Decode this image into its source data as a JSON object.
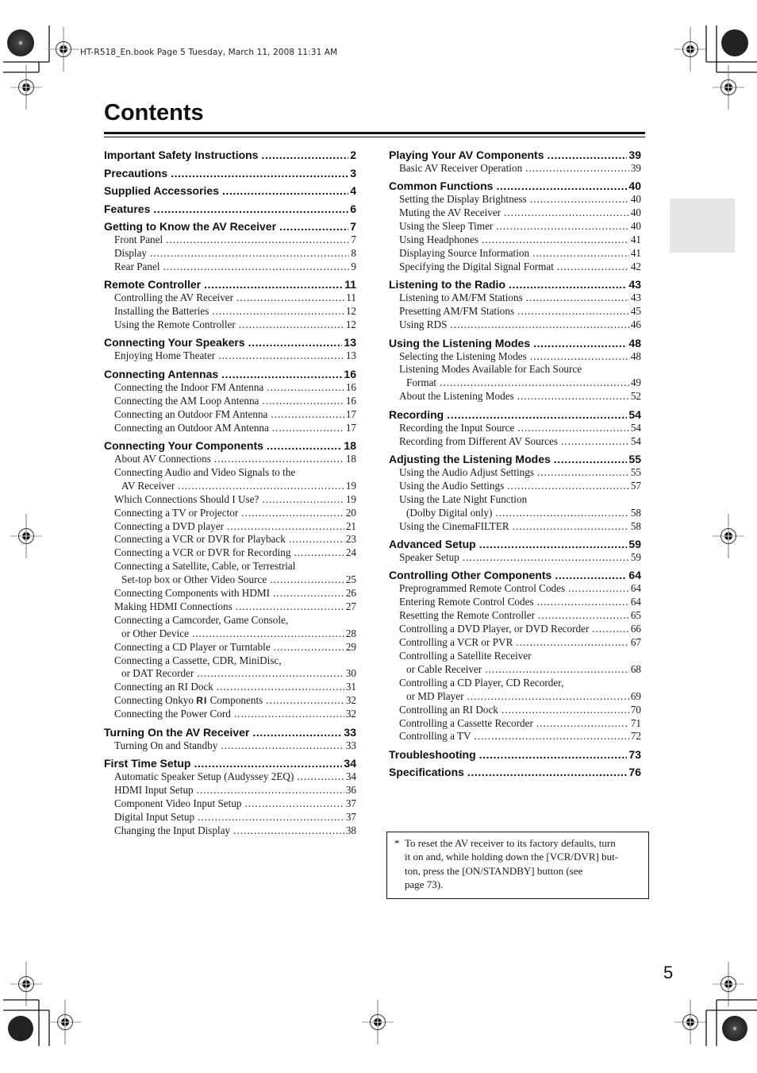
{
  "header": {
    "print_info": "HT-R518_En.book  Page 5  Tuesday, March 11, 2008  11:31 AM"
  },
  "title": "Contents",
  "left_column": [
    {
      "title": "Important Safety Instructions",
      "page": "2",
      "subs": []
    },
    {
      "title": "Precautions",
      "page": "3",
      "subs": []
    },
    {
      "title": "Supplied Accessories",
      "page": "4",
      "subs": []
    },
    {
      "title": "Features",
      "page": "6",
      "subs": []
    },
    {
      "title": "Getting to Know the AV Receiver",
      "page": "7",
      "subs": [
        {
          "title": "Front Panel",
          "page": "7"
        },
        {
          "title": "Display",
          "page": "8"
        },
        {
          "title": "Rear Panel",
          "page": "9"
        }
      ]
    },
    {
      "title": "Remote Controller",
      "page": "11",
      "subs": [
        {
          "title": "Controlling the AV Receiver",
          "page": "11"
        },
        {
          "title": "Installing the Batteries",
          "page": "12"
        },
        {
          "title": "Using the Remote Controller",
          "page": "12"
        }
      ]
    },
    {
      "title": "Connecting Your Speakers",
      "page": "13",
      "subs": [
        {
          "title": "Enjoying Home Theater",
          "page": "13"
        }
      ]
    },
    {
      "title": "Connecting Antennas",
      "page": "16",
      "subs": [
        {
          "title": "Connecting the Indoor FM Antenna",
          "page": "16"
        },
        {
          "title": "Connecting the AM Loop Antenna",
          "page": "16"
        },
        {
          "title": "Connecting an Outdoor FM Antenna",
          "page": "17"
        },
        {
          "title": "Connecting an Outdoor AM Antenna",
          "page": "17"
        }
      ]
    },
    {
      "title": "Connecting Your Components",
      "page": "18",
      "subs": [
        {
          "title": "About AV Connections",
          "page": "18"
        },
        {
          "title": "Connecting Audio and Video Signals to the",
          "cont": "AV Receiver",
          "page": "19"
        },
        {
          "title": "Which Connections Should I Use?",
          "page": "19"
        },
        {
          "title": "Connecting a TV or Projector",
          "page": "20"
        },
        {
          "title": "Connecting a DVD player",
          "page": "21"
        },
        {
          "title": "Connecting a VCR or DVR for Playback",
          "page": "23"
        },
        {
          "title": "Connecting a VCR or DVR for Recording",
          "page": "24"
        },
        {
          "title": "Connecting a Satellite, Cable, or Terrestrial",
          "cont": "Set-top box or Other Video Source",
          "page": "25"
        },
        {
          "title": "Connecting Components with HDMI",
          "page": "26"
        },
        {
          "title": "Making HDMI Connections",
          "page": "27"
        },
        {
          "title": "Connecting a Camcorder, Game Console,",
          "cont": "or Other Device",
          "page": "28"
        },
        {
          "title": "Connecting a CD Player or Turntable",
          "page": "29"
        },
        {
          "title": "Connecting a Cassette, CDR, MiniDisc,",
          "cont": "or DAT Recorder",
          "page": "30"
        },
        {
          "title": "Connecting an RI Dock",
          "page": "31"
        },
        {
          "title": "Connecting Onkyo",
          "logo": "RI",
          "title_after": "Components",
          "page": "32"
        },
        {
          "title": "Connecting the Power Cord",
          "page": "32"
        }
      ]
    },
    {
      "title": "Turning On the AV Receiver",
      "page": "33",
      "subs": [
        {
          "title": "Turning On and Standby",
          "page": "33"
        }
      ]
    },
    {
      "title": "First Time Setup",
      "page": "34",
      "subs": [
        {
          "title": "Automatic Speaker Setup (Audyssey 2EQ)",
          "page": "34"
        },
        {
          "title": "HDMI Input Setup",
          "page": "36"
        },
        {
          "title": "Component Video Input Setup",
          "page": "37"
        },
        {
          "title": "Digital Input Setup",
          "page": "37"
        },
        {
          "title": "Changing the Input Display",
          "page": "38"
        }
      ]
    }
  ],
  "right_column": [
    {
      "title": "Playing Your AV Components",
      "page": "39",
      "subs": [
        {
          "title": "Basic AV Receiver Operation",
          "page": "39"
        }
      ]
    },
    {
      "title": "Common Functions",
      "page": "40",
      "subs": [
        {
          "title": "Setting the Display Brightness",
          "page": "40"
        },
        {
          "title": "Muting the AV Receiver",
          "page": "40"
        },
        {
          "title": "Using the Sleep Timer",
          "page": "40"
        },
        {
          "title": "Using Headphones",
          "page": "41"
        },
        {
          "title": "Displaying Source Information",
          "page": "41"
        },
        {
          "title": "Specifying the Digital Signal Format",
          "page": "42"
        }
      ]
    },
    {
      "title": "Listening to the Radio",
      "page": "43",
      "subs": [
        {
          "title": "Listening to AM/FM Stations",
          "page": "43"
        },
        {
          "title": "Presetting AM/FM Stations",
          "page": "45"
        },
        {
          "title": "Using RDS",
          "page": "46"
        }
      ]
    },
    {
      "title": "Using the Listening Modes",
      "page": "48",
      "subs": [
        {
          "title": "Selecting the Listening Modes",
          "page": "48"
        },
        {
          "title": "Listening Modes Available for Each Source",
          "cont": "Format",
          "page": "49"
        },
        {
          "title": "About the Listening Modes",
          "page": "52"
        }
      ]
    },
    {
      "title": "Recording",
      "page": "54",
      "subs": [
        {
          "title": "Recording the Input Source",
          "page": "54"
        },
        {
          "title": "Recording from Different AV Sources",
          "page": "54"
        }
      ]
    },
    {
      "title": "Adjusting the Listening Modes",
      "page": "55",
      "subs": [
        {
          "title": "Using the Audio Adjust Settings",
          "page": "55"
        },
        {
          "title": "Using the Audio Settings",
          "page": "57"
        },
        {
          "title": "Using the Late Night Function",
          "cont": "(Dolby Digital only)",
          "page": "58"
        },
        {
          "title": "Using the CinemaFILTER",
          "page": "58"
        }
      ]
    },
    {
      "title": "Advanced Setup",
      "page": "59",
      "subs": [
        {
          "title": "Speaker Setup",
          "page": "59"
        }
      ]
    },
    {
      "title": "Controlling Other Components",
      "page": "64",
      "subs": [
        {
          "title": "Preprogrammed Remote Control Codes",
          "page": "64"
        },
        {
          "title": "Entering Remote Control Codes",
          "page": "64"
        },
        {
          "title": "Resetting the Remote Controller",
          "page": "65"
        },
        {
          "title": "Controlling a DVD Player, or DVD Recorder",
          "page": "66"
        },
        {
          "title": "Controlling a VCR or PVR",
          "page": "67"
        },
        {
          "title": "Controlling a Satellite Receiver",
          "cont": "or Cable Receiver",
          "page": "68"
        },
        {
          "title": "Controlling a CD Player, CD Recorder,",
          "cont": "or MD Player",
          "page": "69"
        },
        {
          "title": "Controlling an RI Dock",
          "page": "70"
        },
        {
          "title": "Controlling a Cassette Recorder",
          "page": "71"
        },
        {
          "title": "Controlling a TV",
          "page": "72"
        }
      ]
    },
    {
      "title": "Troubleshooting",
      "page": "73",
      "subs": []
    },
    {
      "title": "Specifications",
      "page": "76",
      "subs": []
    }
  ],
  "note": {
    "marker": "*",
    "lines": [
      "To reset the AV receiver to its factory defaults, turn",
      "it on and, while holding down the [VCR/DVR] but-",
      "ton, press the [ON/STANDBY] button (see",
      "page 73)."
    ]
  },
  "page_number": "5",
  "colors": {
    "text": "#111111",
    "thumb_tab": "#e6e6e6"
  }
}
